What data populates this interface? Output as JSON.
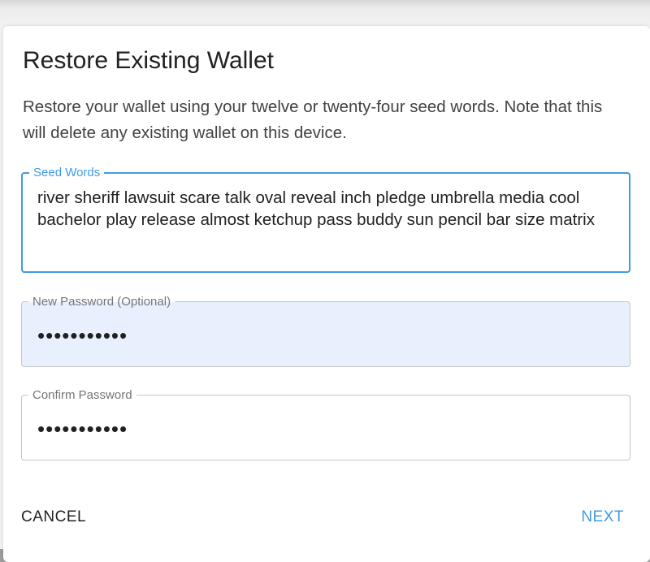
{
  "dialog": {
    "title": "Restore Existing Wallet",
    "description": "Restore your wallet using your twelve or twenty-four seed words. Note that this will delete any existing wallet on this device."
  },
  "seed_field": {
    "label": "Seed Words",
    "value": "river sheriff lawsuit scare talk oval reveal inch pledge umbrella media cool bachelor play release almost ketchup pass buddy sun pencil bar size matrix"
  },
  "new_password_field": {
    "label": "New Password (Optional)",
    "value": "•••••••••••"
  },
  "confirm_password_field": {
    "label": "Confirm Password",
    "value": "•••••••••••"
  },
  "actions": {
    "cancel_label": "CANCEL",
    "next_label": "NEXT"
  },
  "colors": {
    "accent": "#3f9be6",
    "autofill_bg": "#e8f0fe"
  }
}
